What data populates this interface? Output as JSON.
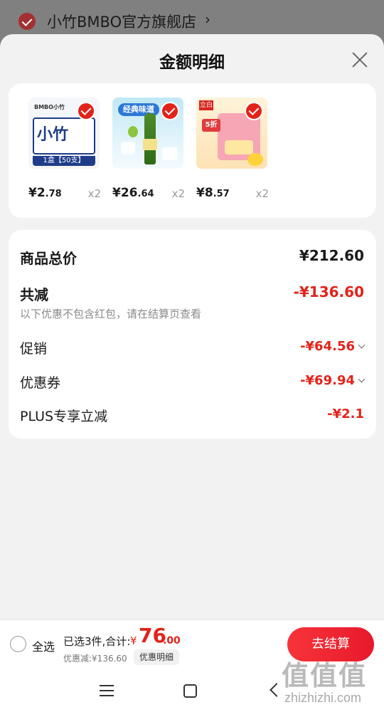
{
  "store": {
    "name": "小竹BMBO官方旗舰店",
    "arrow": "›"
  },
  "sheet": {
    "title": "金额明细"
  },
  "products": [
    {
      "price_int": "¥2",
      "price_dec": ".78",
      "qty": "x2",
      "brand": "BMBO小竹",
      "word": "小竹",
      "band": "1盒【50支】"
    },
    {
      "price_int": "¥26",
      "price_dec": ".64",
      "qty": "x2",
      "banner": "经典味道"
    },
    {
      "price_int": "¥8",
      "price_dec": ".57",
      "qty": "x2",
      "tag": "立白",
      "badge": "5折"
    }
  ],
  "summary": {
    "goods_total_label": "商品总价",
    "goods_total_value": "¥212.60",
    "total_discount_label": "共减",
    "total_discount_value": "-¥136.60",
    "note": "以下优惠不包含红包，请在结算页查看",
    "promo_label": "促销",
    "promo_value": "-¥64.56",
    "coupon_label": "优惠券",
    "coupon_value": "-¥69.94",
    "plus_label": "PLUS专享立减",
    "plus_value": "-¥2.1"
  },
  "bottom": {
    "select_all": "全选",
    "selected_count": "已选3件,合计:",
    "currency": "¥",
    "total_int": "76",
    "total_dec": ".00",
    "saved": "优惠减:¥136.60",
    "detail": "优惠明细",
    "checkout": "去结算"
  },
  "watermark": {
    "glyphs": "值值值",
    "text": "zhizhizhi.com"
  },
  "colors": {
    "accent": "#e2231a",
    "overlay": "#7d7d7d",
    "sheet_bg": "#f2f2f2"
  }
}
